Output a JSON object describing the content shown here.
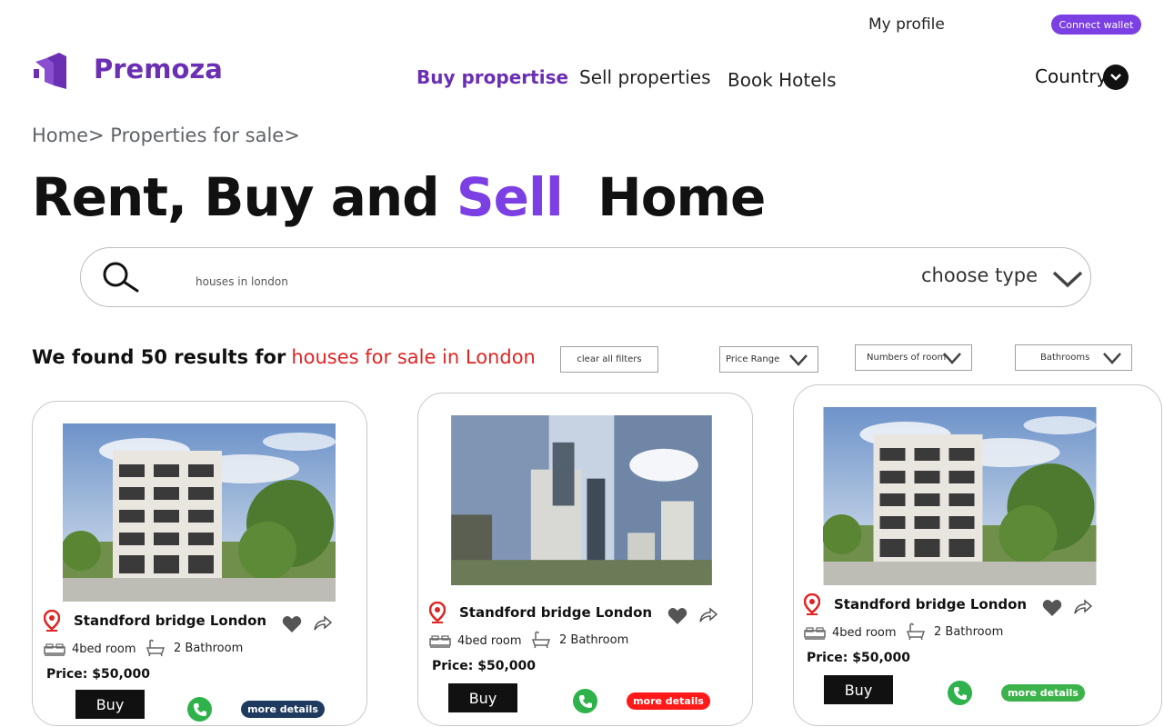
{
  "top_bar": {
    "my_profile": "My profile",
    "connect_wallet": "Connect wallet"
  },
  "brand": {
    "name": "Premoza",
    "color": "#6a2fb2"
  },
  "nav": {
    "buy": "Buy propertise",
    "sell": "Sell properties",
    "hotels": "Book Hotels",
    "country": "Country"
  },
  "breadcrumb": "Home> Properties for sale>",
  "hero": {
    "part1": "Rent, Buy and ",
    "accent": "Sell",
    "part2": "  Home",
    "accent_color": "#7b3fe4"
  },
  "search": {
    "value": "houses in london",
    "choose_type": "choose type"
  },
  "results": {
    "prefix": "We found 50 results for",
    "query": "houses for sale in London"
  },
  "filters": {
    "clear": "clear all filters",
    "price": "Price Range",
    "rooms": "Numbers of room",
    "bathrooms": "Bathrooms"
  },
  "cards": [
    {
      "title": "Standford bridge London",
      "beds": "4bed room",
      "baths": "2 Bathroom",
      "price": "Price: $50,000",
      "buy": "Buy",
      "more": "more  details",
      "more_color": "#1f3a5f",
      "image": "modern-apartment-building"
    },
    {
      "title": "Standford bridge London",
      "beds": "4bed room",
      "baths": "2 Bathroom",
      "price": "Price: $50,000",
      "buy": "Buy",
      "more": "more  details",
      "more_color": "#ff1a1a",
      "image": "city-skyscrapers-through-door"
    },
    {
      "title": "Standford bridge London",
      "beds": "4bed room",
      "baths": "2 Bathroom",
      "price": "Price: $50,000",
      "buy": "Buy",
      "more": "more  details",
      "more_color": "#3cb34a",
      "image": "modern-apartment-building"
    }
  ],
  "icons": {
    "location": "location-pin-icon",
    "favorite": "heart-icon",
    "share": "share-icon",
    "bed": "bed-icon",
    "bath": "bathtub-icon",
    "phone": "phone-icon"
  }
}
